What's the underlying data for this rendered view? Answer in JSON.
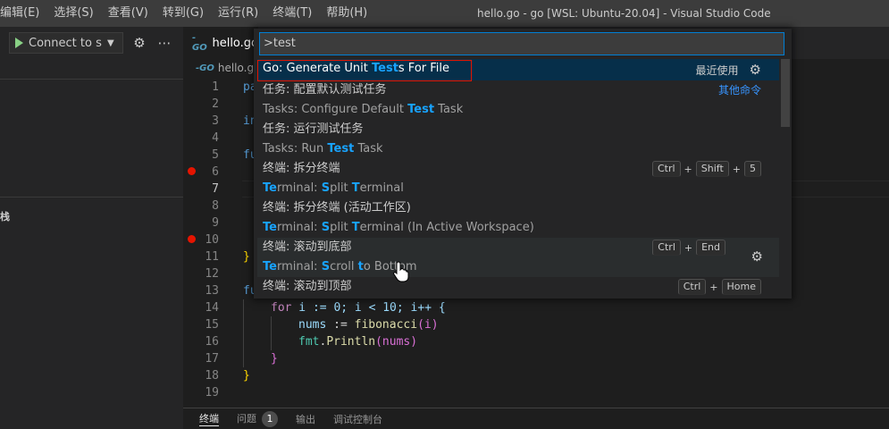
{
  "menu": [
    "编辑(E)",
    "选择(S)",
    "查看(V)",
    "转到(G)",
    "运行(R)",
    "终端(T)",
    "帮助(H)"
  ],
  "window_title": "hello.go - go [WSL: Ubuntu-20.04] - Visual Studio Code",
  "sidebar": {
    "connect_label": "Connect to se",
    "stack_label": "栈"
  },
  "editor": {
    "tab_label": "hello.go",
    "breadcrumb": "hello.go",
    "line_numbers": [
      "1",
      "2",
      "3",
      "4",
      "5",
      "6",
      "7",
      "8",
      "9",
      "10",
      "11",
      "12",
      "13",
      "14",
      "15",
      "16",
      "17",
      "18",
      "19"
    ],
    "breakpoint_lines": [
      6,
      10
    ],
    "partial_code": {
      "l1": "pa",
      "l3": "in",
      "l5": "fu",
      "l11": "}",
      "l13": "fu"
    },
    "code": {
      "l14_kw": "for",
      "l14_rest": " i := 0; i < 10; i++ {",
      "l15_var": "nums",
      "l15_op": " := ",
      "l15_fn": "fibonacci",
      "l15_arg": "(i)",
      "l16_pkg": "fmt",
      "l16_dot": ".",
      "l16_fn": "Println",
      "l16_arg": "(nums)",
      "l17": "}",
      "l18": "}"
    }
  },
  "panel": {
    "tabs": [
      "终端",
      "问题",
      "输出",
      "调试控制台"
    ],
    "problems_count": "1"
  },
  "palette": {
    "input_value": ">test",
    "items": [
      {
        "label_pre": "Go: Generate Unit ",
        "label_hl": "Tes",
        "label_hl2": "t",
        "label_post": "s For File",
        "right": "最近使用"
      },
      {
        "label": "任务: 配置默认测试任务",
        "sub_pre": "Tasks: Configure Default ",
        "sub_hl": "Test",
        "sub_post": " Task",
        "right_link": "其他命令"
      },
      {
        "label": "任务: 运行测试任务",
        "sub_pre": "Tasks: Run ",
        "sub_hl": "Test",
        "sub_post": " Task"
      },
      {
        "label": "终端: 拆分终端",
        "sub_hl1": "Te",
        "sub_mid1": "rminal: ",
        "sub_hl2": "S",
        "sub_mid2": "plit ",
        "sub_hl3": "T",
        "sub_post": "erminal",
        "keys": [
          "Ctrl",
          "Shift",
          "5"
        ]
      },
      {
        "label": "终端: 拆分终端 (活动工作区)",
        "sub_hl1": "Te",
        "sub_mid1": "rminal: ",
        "sub_hl2": "S",
        "sub_mid2": "plit ",
        "sub_hl3": "T",
        "sub_post": "erminal (In Active Workspace)"
      },
      {
        "label": "终端: 滚动到底部",
        "sub_hl1": "Te",
        "sub_mid1": "rminal: ",
        "sub_hl2": "S",
        "sub_mid2": "croll ",
        "sub_hl3": "t",
        "sub_post": "o Bottom",
        "keys": [
          "Ctrl",
          "End"
        ]
      },
      {
        "label": "终端: 滚动到顶部",
        "keys": [
          "Ctrl",
          "Home"
        ]
      }
    ]
  }
}
